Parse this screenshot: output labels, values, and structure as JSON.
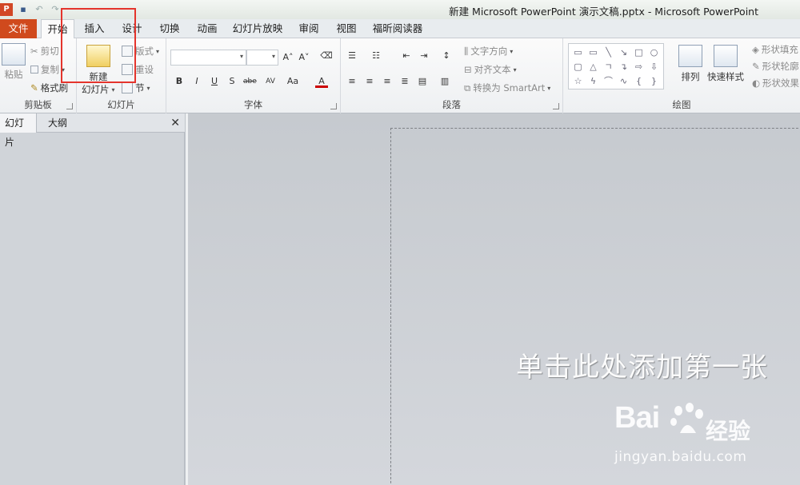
{
  "window": {
    "title": "新建 Microsoft PowerPoint 演示文稿.pptx - Microsoft PowerPoint"
  },
  "qat": {
    "logo": "P"
  },
  "tabs": [
    {
      "label": "文件"
    },
    {
      "label": "开始"
    },
    {
      "label": "插入"
    },
    {
      "label": "设计"
    },
    {
      "label": "切换"
    },
    {
      "label": "动画"
    },
    {
      "label": "幻灯片放映"
    },
    {
      "label": "审阅"
    },
    {
      "label": "视图"
    },
    {
      "label": "福昕阅读器"
    }
  ],
  "clipboard": {
    "paste": "粘贴",
    "cut": "剪切",
    "copy": "复制",
    "format_painter": "格式刷",
    "label": "剪贴板"
  },
  "slides": {
    "new": "新建",
    "new2": "幻灯片",
    "layout": "版式",
    "reset": "重设",
    "section": "节",
    "label": "幻灯片"
  },
  "font": {
    "label": "字体",
    "bold": "B",
    "italic": "I",
    "underline": "U",
    "strike": "S",
    "abc": "abe",
    "spacing": "AV",
    "case": "Aa",
    "color": "A"
  },
  "paragraph": {
    "text_direction": "文字方向",
    "align_text": "对齐文本",
    "smartart": "转换为 SmartArt",
    "label": "段落"
  },
  "drawing": {
    "arrange": "排列",
    "quick_styles": "快速样式",
    "shape_fill": "形状填充",
    "shape_outline": "形状轮廓",
    "shape_effects": "形状效果",
    "label": "绘图"
  },
  "pane": {
    "tab_slides": "幻灯片",
    "tab_outline": "大纲",
    "close": "✕"
  },
  "slide": {
    "title_placeholder": "单击此处添加第一张"
  },
  "watermark": {
    "brand": "Bai",
    "brand2": "经验",
    "url": "jingyan.baidu.com"
  },
  "colors": {
    "file_tab": "#d04a1d",
    "highlight": "#e4342c",
    "canvas": "#cdd1d7"
  }
}
